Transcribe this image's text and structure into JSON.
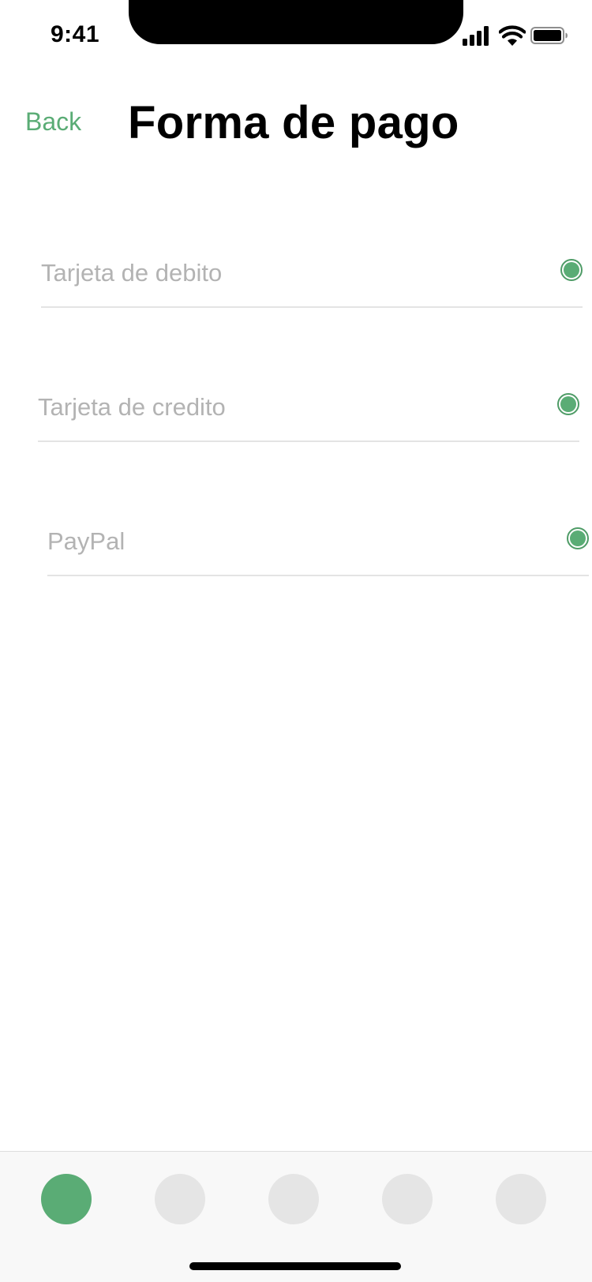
{
  "status_bar": {
    "time": "9:41",
    "icons": [
      "cellular-signal-icon",
      "wifi-icon",
      "battery-icon"
    ]
  },
  "header": {
    "back_label": "Back",
    "title": "Forma de pago"
  },
  "payment_options": [
    {
      "label": "Tarjeta de debito"
    },
    {
      "label": "Tarjeta de credito"
    },
    {
      "label": "PayPal"
    }
  ],
  "pager": {
    "count": 5,
    "active_index": 0
  },
  "colors": {
    "accent": "#5aac75",
    "placeholder_text": "#b3b3b3",
    "divider": "#e4e4e4",
    "inactive_dot": "#e5e5e5"
  }
}
